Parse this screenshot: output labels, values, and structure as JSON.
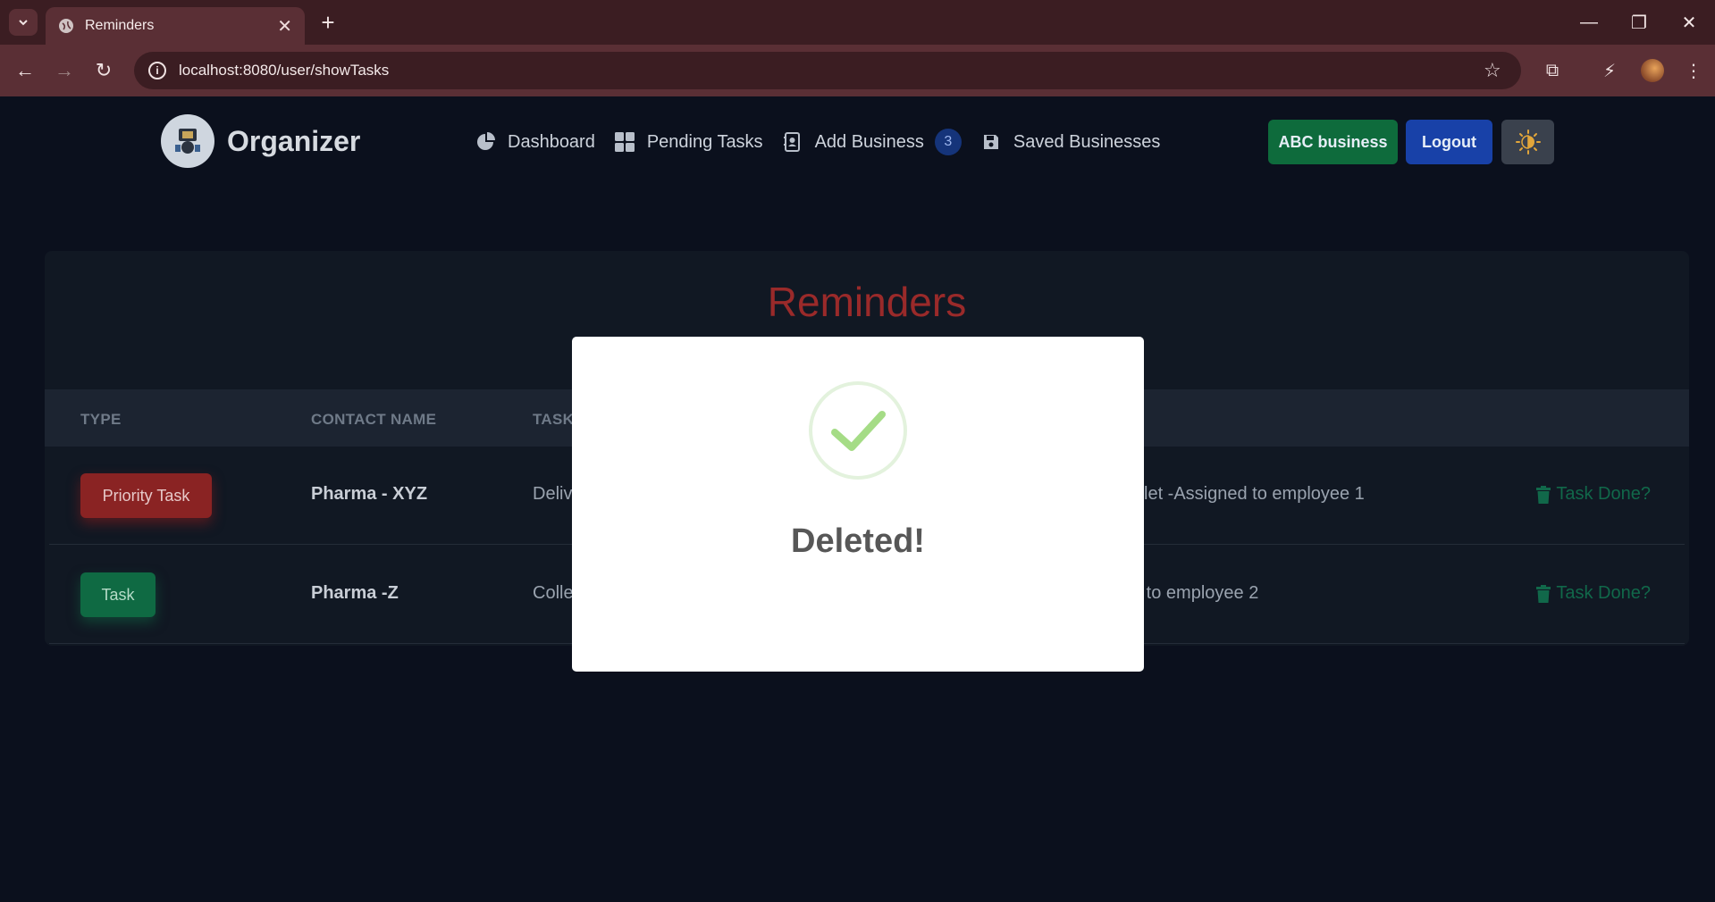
{
  "browser": {
    "tab_title": "Reminders",
    "url": "localhost:8080/user/showTasks"
  },
  "app": {
    "brand": "Organizer",
    "nav": [
      {
        "label": "Dashboard",
        "icon": "pie-chart-icon"
      },
      {
        "label": "Pending Tasks",
        "icon": "grid-icon"
      },
      {
        "label": "Add Business",
        "icon": "address-book-icon",
        "badge": "3"
      },
      {
        "label": "Saved Businesses",
        "icon": "save-icon"
      }
    ],
    "business_button": "ABC business",
    "logout_button": "Logout",
    "theme_icon": "sun-icon"
  },
  "reminders": {
    "title": "Reminders",
    "headers": [
      "TYPE",
      "CONTACT NAME",
      "TASK"
    ],
    "rows": [
      {
        "type": "Priority Task",
        "contact": "Pharma - XYZ",
        "task": "Deliv",
        "desc": "let -Assigned to employee 1",
        "action": "Task Done?"
      },
      {
        "type": "Task",
        "contact": "Pharma -Z",
        "task": "Colle",
        "desc": "d to employee 2",
        "action": "Task Done?"
      }
    ]
  },
  "modal": {
    "title": "Deleted!",
    "icon": "check-icon"
  },
  "colors": {
    "priority": "#8a2323",
    "task": "#0f6a43",
    "accent_title": "#9a2a2a"
  }
}
